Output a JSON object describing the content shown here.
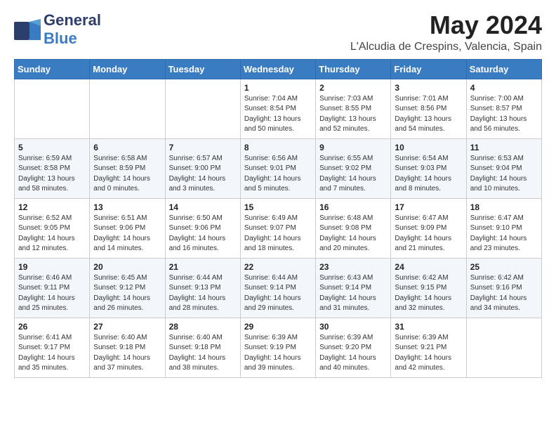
{
  "header": {
    "logo_general": "General",
    "logo_blue": "Blue",
    "title": "May 2024",
    "subtitle": "L'Alcudia de Crespins, Valencia, Spain"
  },
  "days_of_week": [
    "Sunday",
    "Monday",
    "Tuesday",
    "Wednesday",
    "Thursday",
    "Friday",
    "Saturday"
  ],
  "weeks": [
    [
      {
        "day": "",
        "sunrise": "",
        "sunset": "",
        "daylight": ""
      },
      {
        "day": "",
        "sunrise": "",
        "sunset": "",
        "daylight": ""
      },
      {
        "day": "",
        "sunrise": "",
        "sunset": "",
        "daylight": ""
      },
      {
        "day": "1",
        "sunrise": "Sunrise: 7:04 AM",
        "sunset": "Sunset: 8:54 PM",
        "daylight": "Daylight: 13 hours and 50 minutes."
      },
      {
        "day": "2",
        "sunrise": "Sunrise: 7:03 AM",
        "sunset": "Sunset: 8:55 PM",
        "daylight": "Daylight: 13 hours and 52 minutes."
      },
      {
        "day": "3",
        "sunrise": "Sunrise: 7:01 AM",
        "sunset": "Sunset: 8:56 PM",
        "daylight": "Daylight: 13 hours and 54 minutes."
      },
      {
        "day": "4",
        "sunrise": "Sunrise: 7:00 AM",
        "sunset": "Sunset: 8:57 PM",
        "daylight": "Daylight: 13 hours and 56 minutes."
      }
    ],
    [
      {
        "day": "5",
        "sunrise": "Sunrise: 6:59 AM",
        "sunset": "Sunset: 8:58 PM",
        "daylight": "Daylight: 13 hours and 58 minutes."
      },
      {
        "day": "6",
        "sunrise": "Sunrise: 6:58 AM",
        "sunset": "Sunset: 8:59 PM",
        "daylight": "Daylight: 14 hours and 0 minutes."
      },
      {
        "day": "7",
        "sunrise": "Sunrise: 6:57 AM",
        "sunset": "Sunset: 9:00 PM",
        "daylight": "Daylight: 14 hours and 3 minutes."
      },
      {
        "day": "8",
        "sunrise": "Sunrise: 6:56 AM",
        "sunset": "Sunset: 9:01 PM",
        "daylight": "Daylight: 14 hours and 5 minutes."
      },
      {
        "day": "9",
        "sunrise": "Sunrise: 6:55 AM",
        "sunset": "Sunset: 9:02 PM",
        "daylight": "Daylight: 14 hours and 7 minutes."
      },
      {
        "day": "10",
        "sunrise": "Sunrise: 6:54 AM",
        "sunset": "Sunset: 9:03 PM",
        "daylight": "Daylight: 14 hours and 8 minutes."
      },
      {
        "day": "11",
        "sunrise": "Sunrise: 6:53 AM",
        "sunset": "Sunset: 9:04 PM",
        "daylight": "Daylight: 14 hours and 10 minutes."
      }
    ],
    [
      {
        "day": "12",
        "sunrise": "Sunrise: 6:52 AM",
        "sunset": "Sunset: 9:05 PM",
        "daylight": "Daylight: 14 hours and 12 minutes."
      },
      {
        "day": "13",
        "sunrise": "Sunrise: 6:51 AM",
        "sunset": "Sunset: 9:06 PM",
        "daylight": "Daylight: 14 hours and 14 minutes."
      },
      {
        "day": "14",
        "sunrise": "Sunrise: 6:50 AM",
        "sunset": "Sunset: 9:06 PM",
        "daylight": "Daylight: 14 hours and 16 minutes."
      },
      {
        "day": "15",
        "sunrise": "Sunrise: 6:49 AM",
        "sunset": "Sunset: 9:07 PM",
        "daylight": "Daylight: 14 hours and 18 minutes."
      },
      {
        "day": "16",
        "sunrise": "Sunrise: 6:48 AM",
        "sunset": "Sunset: 9:08 PM",
        "daylight": "Daylight: 14 hours and 20 minutes."
      },
      {
        "day": "17",
        "sunrise": "Sunrise: 6:47 AM",
        "sunset": "Sunset: 9:09 PM",
        "daylight": "Daylight: 14 hours and 21 minutes."
      },
      {
        "day": "18",
        "sunrise": "Sunrise: 6:47 AM",
        "sunset": "Sunset: 9:10 PM",
        "daylight": "Daylight: 14 hours and 23 minutes."
      }
    ],
    [
      {
        "day": "19",
        "sunrise": "Sunrise: 6:46 AM",
        "sunset": "Sunset: 9:11 PM",
        "daylight": "Daylight: 14 hours and 25 minutes."
      },
      {
        "day": "20",
        "sunrise": "Sunrise: 6:45 AM",
        "sunset": "Sunset: 9:12 PM",
        "daylight": "Daylight: 14 hours and 26 minutes."
      },
      {
        "day": "21",
        "sunrise": "Sunrise: 6:44 AM",
        "sunset": "Sunset: 9:13 PM",
        "daylight": "Daylight: 14 hours and 28 minutes."
      },
      {
        "day": "22",
        "sunrise": "Sunrise: 6:44 AM",
        "sunset": "Sunset: 9:14 PM",
        "daylight": "Daylight: 14 hours and 29 minutes."
      },
      {
        "day": "23",
        "sunrise": "Sunrise: 6:43 AM",
        "sunset": "Sunset: 9:14 PM",
        "daylight": "Daylight: 14 hours and 31 minutes."
      },
      {
        "day": "24",
        "sunrise": "Sunrise: 6:42 AM",
        "sunset": "Sunset: 9:15 PM",
        "daylight": "Daylight: 14 hours and 32 minutes."
      },
      {
        "day": "25",
        "sunrise": "Sunrise: 6:42 AM",
        "sunset": "Sunset: 9:16 PM",
        "daylight": "Daylight: 14 hours and 34 minutes."
      }
    ],
    [
      {
        "day": "26",
        "sunrise": "Sunrise: 6:41 AM",
        "sunset": "Sunset: 9:17 PM",
        "daylight": "Daylight: 14 hours and 35 minutes."
      },
      {
        "day": "27",
        "sunrise": "Sunrise: 6:40 AM",
        "sunset": "Sunset: 9:18 PM",
        "daylight": "Daylight: 14 hours and 37 minutes."
      },
      {
        "day": "28",
        "sunrise": "Sunrise: 6:40 AM",
        "sunset": "Sunset: 9:18 PM",
        "daylight": "Daylight: 14 hours and 38 minutes."
      },
      {
        "day": "29",
        "sunrise": "Sunrise: 6:39 AM",
        "sunset": "Sunset: 9:19 PM",
        "daylight": "Daylight: 14 hours and 39 minutes."
      },
      {
        "day": "30",
        "sunrise": "Sunrise: 6:39 AM",
        "sunset": "Sunset: 9:20 PM",
        "daylight": "Daylight: 14 hours and 40 minutes."
      },
      {
        "day": "31",
        "sunrise": "Sunrise: 6:39 AM",
        "sunset": "Sunset: 9:21 PM",
        "daylight": "Daylight: 14 hours and 42 minutes."
      },
      {
        "day": "",
        "sunrise": "",
        "sunset": "",
        "daylight": ""
      }
    ]
  ]
}
